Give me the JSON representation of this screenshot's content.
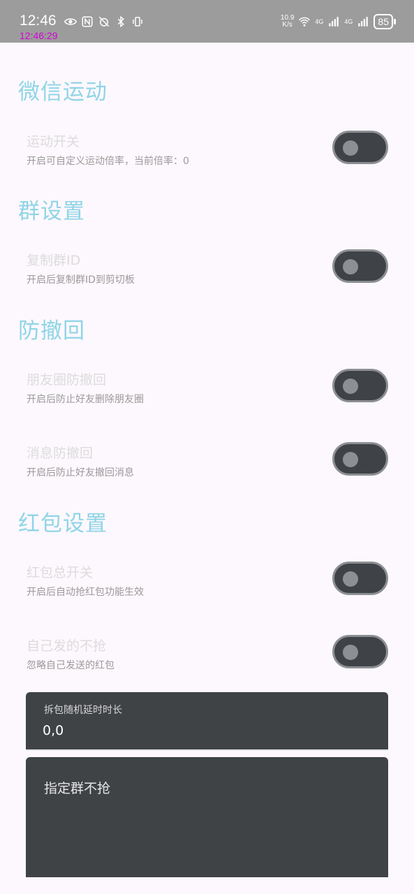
{
  "status_bar": {
    "time": "12:46",
    "clock_overlay": "12:46:29",
    "net_speed_value": "10.9",
    "net_speed_unit": "K/s",
    "signal1_label": "4G",
    "signal2_label": "4G",
    "battery": "85"
  },
  "sections": {
    "wechat_sport": {
      "title": "微信运动",
      "sport_switch": {
        "title": "运动开关",
        "subtitle": "开启可自定义运动倍率，当前倍率：0",
        "on": false
      }
    },
    "group": {
      "title": "群设置",
      "copy_group_id": {
        "title": "复制群ID",
        "subtitle": "开启后复制群ID到剪切板",
        "on": false
      }
    },
    "anti_recall": {
      "title": "防撤回",
      "moments": {
        "title": "朋友圈防撤回",
        "subtitle": "开启后防止好友删除朋友圈",
        "on": false
      },
      "messages": {
        "title": "消息防撤回",
        "subtitle": "开启后防止好友撤回消息",
        "on": false
      }
    },
    "red_packet": {
      "title": "红包设置",
      "master": {
        "title": "红包总开关",
        "subtitle": "开启后自动抢红包功能生效",
        "on": false
      },
      "ignore_self": {
        "title": "自己发的不抢",
        "subtitle": "忽略自己发送的红包",
        "on": false
      },
      "delay_field": {
        "label": "拆包随机延时时长",
        "value": "0,0"
      },
      "exclude_groups_field": {
        "label": "指定群不抢"
      }
    }
  }
}
